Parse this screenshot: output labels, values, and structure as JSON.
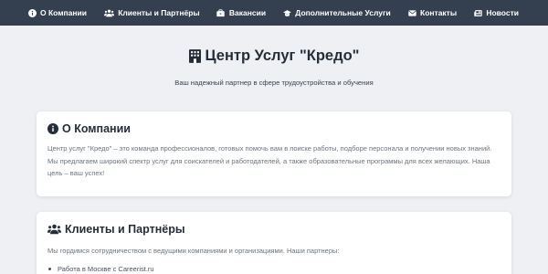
{
  "nav": {
    "items": [
      {
        "icon": "info-circle-icon",
        "label": "О Компании"
      },
      {
        "icon": "users-icon",
        "label": "Клиенты и Партнёры"
      },
      {
        "icon": "briefcase-icon",
        "label": "Вакансии"
      },
      {
        "icon": "graduation-cap-icon",
        "label": "Дополнительные Услуги"
      },
      {
        "icon": "envelope-icon",
        "label": "Контакты"
      },
      {
        "icon": "newspaper-icon",
        "label": "Новости"
      }
    ]
  },
  "hero": {
    "icon": "building-icon",
    "title": "Центр Услуг \"Кредо\"",
    "subtitle": "Ваш надежный партнер в сфере трудоустройства и обучения"
  },
  "about": {
    "icon": "info-circle-icon",
    "heading": "О Компании",
    "text": "Центр услуг \"Кредо\" – это команда профессионалов, готовых помочь вам в поиске работы, подборе персонала и получении новых знаний. Мы предлагаем широкий спектр услуг для соискателей и работодателей, а также образовательные программы для всех желающих. Наша цель – ваш успех!"
  },
  "clients": {
    "icon": "users-icon",
    "heading": "Клиенты и Партнёры",
    "text": "Мы гордимся сотрудничеством с ведущими компаниями и организациями. Наши партнеры:",
    "partners": [
      "Работа в Москве с Careerist.ru"
    ]
  },
  "colors": {
    "nav_background": "#344050",
    "page_background": "#eef0f3",
    "card_background": "#ffffff",
    "heading_text": "#252d38",
    "body_text": "#6b7380"
  }
}
